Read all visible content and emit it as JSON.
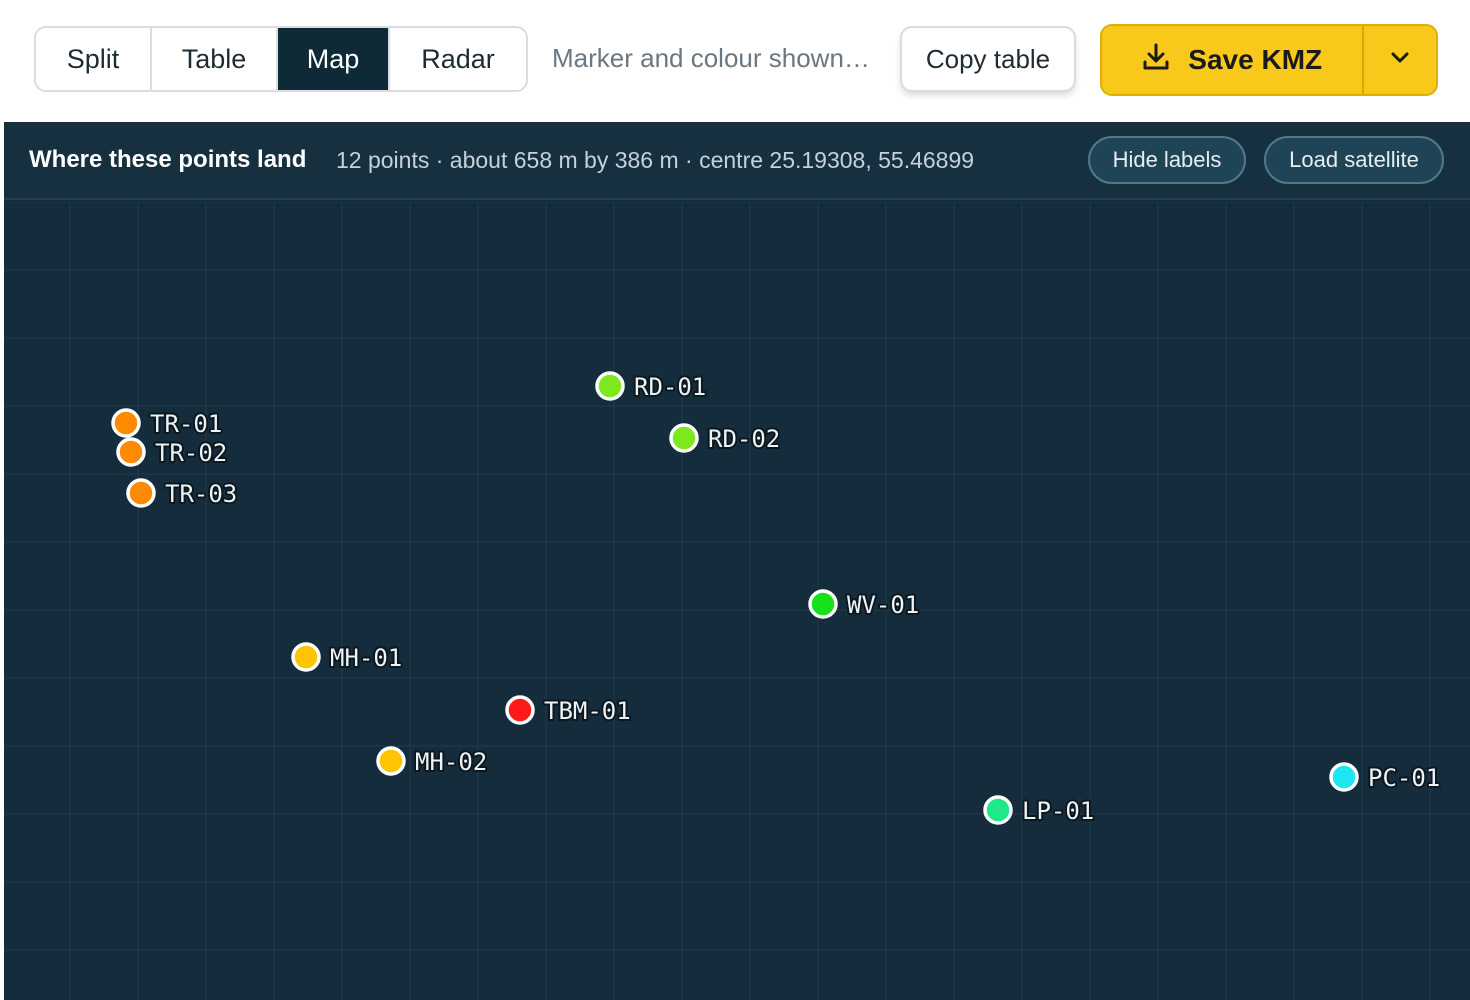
{
  "toolbar": {
    "tabs": [
      {
        "label": "Split",
        "active": false
      },
      {
        "label": "Table",
        "active": false
      },
      {
        "label": "Map",
        "active": true
      },
      {
        "label": "Radar",
        "active": false
      }
    ],
    "hint": "Marker and colour shown…",
    "copy_label": "Copy table",
    "save_label": "Save KMZ",
    "save_icon": "download-icon",
    "dropdown_icon": "chevron-down-icon",
    "accent_color": "#f8c91a"
  },
  "map_panel": {
    "title": "Where these points land",
    "meta": "12 points · about 658 m by 386 m · centre 25.19308, 55.46899",
    "hide_labels": "Hide labels",
    "load_satellite": "Load satellite",
    "background_color": "#152c3c"
  },
  "points": [
    {
      "id": "TR-01",
      "color": "#ff8a00"
    },
    {
      "id": "TR-02",
      "color": "#ff8a00"
    },
    {
      "id": "TR-03",
      "color": "#ff8a00"
    },
    {
      "id": "RD-01",
      "color": "#7ee81e"
    },
    {
      "id": "RD-02",
      "color": "#7ee81e"
    },
    {
      "id": "WV-01",
      "color": "#18e01b"
    },
    {
      "id": "MH-01",
      "color": "#ffc400"
    },
    {
      "id": "TBM-01",
      "color": "#ff1a1a"
    },
    {
      "id": "MH-02",
      "color": "#ffc400"
    },
    {
      "id": "LP-01",
      "color": "#1ee887"
    },
    {
      "id": "PC-01",
      "color": "#1ee6f0"
    }
  ]
}
